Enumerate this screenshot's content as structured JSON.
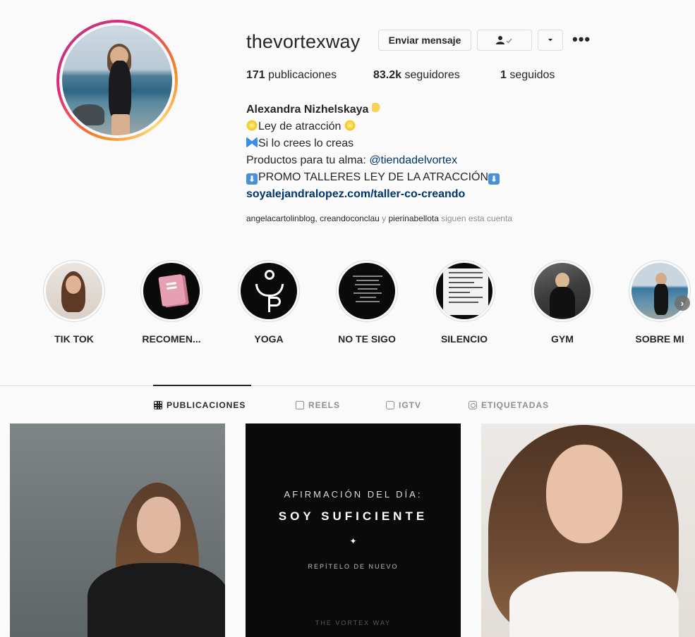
{
  "profile": {
    "username": "thevortexway",
    "message_button": "Enviar mensaje",
    "follow_icon": "person-check",
    "dropdown_icon": "chevron-down",
    "more_icon": "•••",
    "stats": {
      "posts_count": "171",
      "posts_label": "publicaciones",
      "followers_count": "83.2k",
      "followers_label": "seguidores",
      "following_count": "1",
      "following_label": "seguidos"
    },
    "bio": {
      "name": "Alexandra Nizhelskaya",
      "line1": "Ley de atracción",
      "line2": "Si lo crees lo creas",
      "line3_prefix": "Productos para tu alma: ",
      "line3_mention": "@tiendadelvortex",
      "line4": "PROMO TALLERES LEY DE LA ATRACCIÓN",
      "link": "soyalejandralopez.com/taller-co-creando"
    },
    "followed_by": {
      "user1": "angelacartolinblog",
      "sep1": ", ",
      "user2": "creandoconclau",
      "sep2": " y ",
      "user3": "pierinabellota",
      "suffix": " siguen esta cuenta"
    }
  },
  "highlights": [
    {
      "label": "TIK TOK"
    },
    {
      "label": "RECOMEN..."
    },
    {
      "label": "YOGA"
    },
    {
      "label": "NO TE SIGO"
    },
    {
      "label": "SILENCIO"
    },
    {
      "label": "GYM"
    },
    {
      "label": "SOBRE MI"
    }
  ],
  "tabs": [
    {
      "label": "PUBLICACIONES",
      "icon": "grid-icon",
      "active": true
    },
    {
      "label": "REELS",
      "icon": "reels-icon",
      "active": false
    },
    {
      "label": "IGTV",
      "icon": "tv-icon",
      "active": false
    },
    {
      "label": "ETIQUETADAS",
      "icon": "tag-icon",
      "active": false
    }
  ],
  "posts": {
    "post2": {
      "line1": "AFIRMACIÓN DEL DÍA:",
      "line2": "SOY SUFICIENTE",
      "star": "✦",
      "line3": "REPÍTELO DE NUEVO",
      "footer": "THE VORTEX WAY"
    }
  }
}
